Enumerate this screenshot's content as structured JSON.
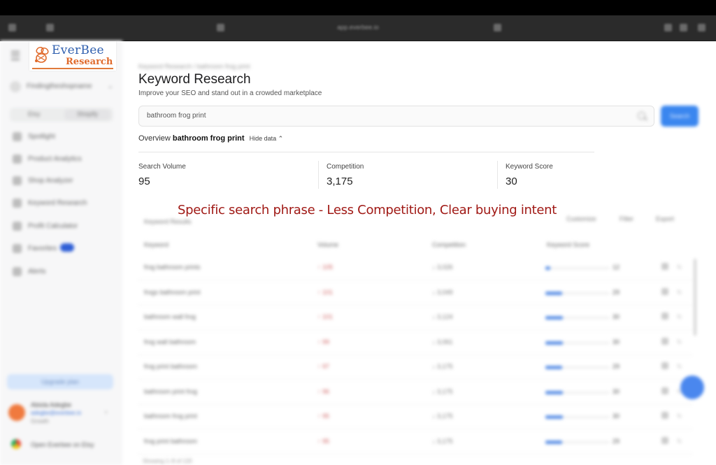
{
  "browser": {
    "url": "app.everbee.io"
  },
  "logo": {
    "line1": "EverBee",
    "line2": "Research"
  },
  "sidebar": {
    "store_name": "Findingtheshopname",
    "segment": [
      "Etsy",
      "Shopify"
    ],
    "items": [
      {
        "label": "Spotlight",
        "icon": "spotlight-icon"
      },
      {
        "label": "Product Analytics",
        "icon": "chart-icon"
      },
      {
        "label": "Shop Analyzer",
        "icon": "shop-icon"
      },
      {
        "label": "Keyword Research",
        "icon": "key-icon"
      },
      {
        "label": "Profit Calculator",
        "icon": "calculator-icon"
      },
      {
        "label": "Favorites",
        "icon": "heart-icon"
      },
      {
        "label": "Alerts",
        "icon": "bell-icon"
      }
    ],
    "upgrade_label": "Upgrade plan",
    "user": {
      "name": "Abiola Adegbe",
      "email": "adegbe@everbee.io",
      "plan": "Growth"
    },
    "chrome_extension_label": "Open Everbee on Etsy"
  },
  "main": {
    "breadcrumb": "Keyword Research / bathroom frog print",
    "title": "Keyword Research",
    "subtitle": "Improve your SEO and stand out in a crowded marketplace",
    "search": {
      "value": "bathroom frog print",
      "button_label": "Search"
    },
    "overview": {
      "label": "Overview",
      "keyword": "bathroom frog print",
      "toggle_label": "Hide data"
    },
    "metrics": [
      {
        "label": "Search Volume",
        "value": "95"
      },
      {
        "label": "Competition",
        "value": "3,175"
      },
      {
        "label": "Keyword Score",
        "value": "30"
      }
    ],
    "table": {
      "title": "Keyword Results",
      "buttons": [
        "Customize",
        "Filter",
        "Export"
      ],
      "columns": [
        "Keyword",
        "Volume",
        "Competition",
        "Keyword Score"
      ],
      "rows": [
        {
          "keyword": "frog bathroom prints",
          "volume": "↑ 105",
          "competition": "↓ 3,026",
          "score": "12",
          "fill": 0.08
        },
        {
          "keyword": "frogs bathroom print",
          "volume": "↑ 101",
          "competition": "↓ 3,049",
          "score": "29",
          "fill": 0.26
        },
        {
          "keyword": "bathroom wall frog",
          "volume": "↑ 101",
          "competition": "↓ 3,124",
          "score": "30",
          "fill": 0.27
        },
        {
          "keyword": "frog wall bathroom",
          "volume": "↑ 99",
          "competition": "↓ 3,061",
          "score": "30",
          "fill": 0.27
        },
        {
          "keyword": "frog print bathroom",
          "volume": "↑ 97",
          "competition": "↓ 3,175",
          "score": "29",
          "fill": 0.26
        },
        {
          "keyword": "bathroom print frog",
          "volume": "↑ 96",
          "competition": "↓ 3,175",
          "score": "30",
          "fill": 0.27
        },
        {
          "keyword": "bathroom frog print",
          "volume": "↑ 95",
          "competition": "↓ 3,175",
          "score": "30",
          "fill": 0.27
        },
        {
          "keyword": "frog print bathroom",
          "volume": "↑ 95",
          "competition": "↓ 3,175",
          "score": "29",
          "fill": 0.26
        }
      ],
      "footer": "Showing 1–8 of 120"
    }
  },
  "annotation": "Specific search phrase - Less Competition, Clear buying intent",
  "colors": {
    "accent": "#3a86ef",
    "annotation": "#a01915",
    "logo_blue": "#2f5fae",
    "logo_orange": "#e06a2b"
  }
}
